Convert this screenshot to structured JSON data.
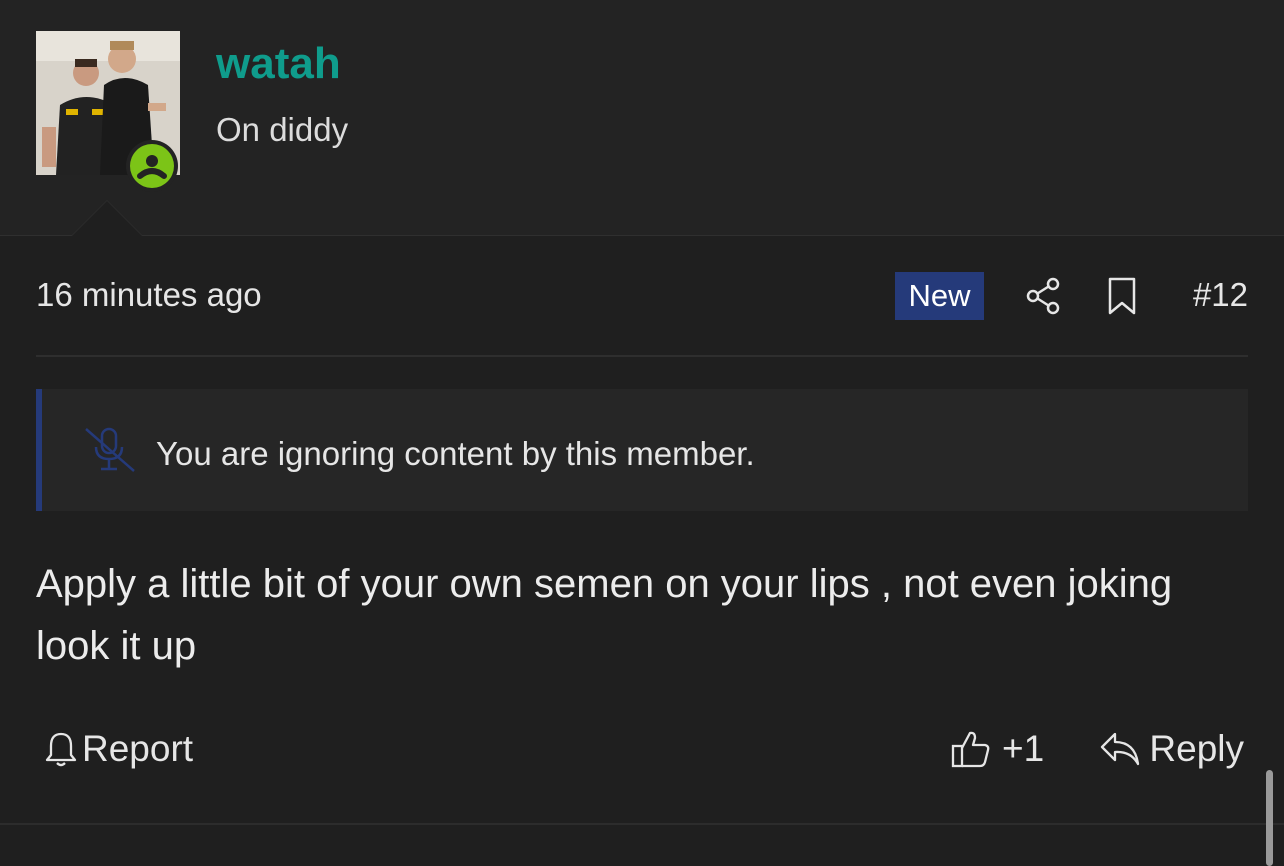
{
  "post": {
    "username": "watah",
    "user_title": "On diddy",
    "timestamp": "16 minutes ago",
    "new_badge": "New",
    "post_number": "#12",
    "ignored_notice": "You are ignoring content by this member.",
    "message": "Apply a little bit of your own semen on your lips , not even joking look it up",
    "actions": {
      "report": "Report",
      "like_count": "+1",
      "reply": "Reply"
    }
  },
  "icons": {
    "avatar": "user-avatar-photo",
    "online": "online-status-icon",
    "share": "share-icon",
    "bookmark": "bookmark-icon",
    "ignored": "muted-microphone-icon",
    "report": "bell-icon",
    "like": "thumbs-up-icon",
    "reply": "reply-arrow-icon"
  },
  "colors": {
    "background": "#1f1f1f",
    "username": "#0f9c8c",
    "new_badge": "#253a7a",
    "online": "#7cc417"
  }
}
